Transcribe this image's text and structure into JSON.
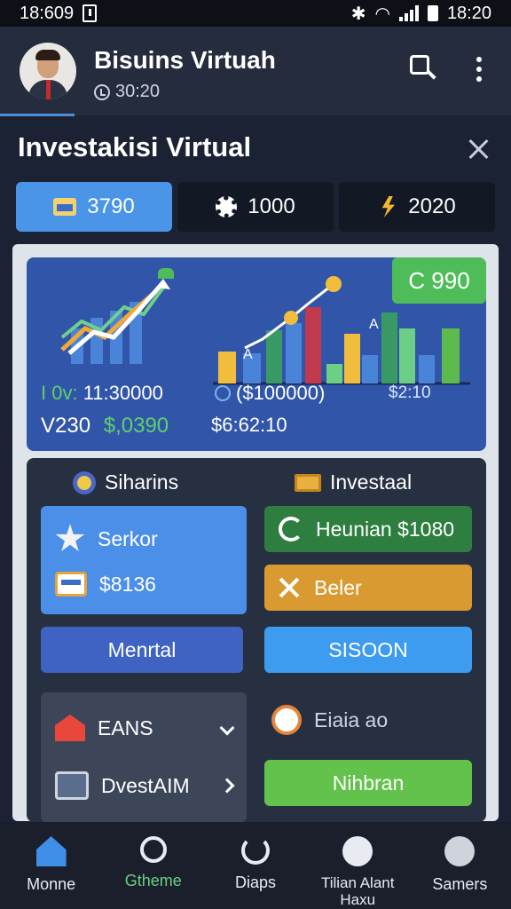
{
  "status_bar": {
    "time_left": "18:609",
    "time_right": "18:20"
  },
  "header": {
    "title": "Bisuins Virtuah",
    "subtitle": "30:20"
  },
  "section_title": "Investakisi Virtual",
  "chips": [
    {
      "label": "3790",
      "icon": "wallet-icon",
      "active": true
    },
    {
      "label": "1000",
      "icon": "gear-icon",
      "active": false
    },
    {
      "label": "2020",
      "icon": "bolt-icon",
      "active": false
    }
  ],
  "overview": {
    "badge": "C 990",
    "stat1_label": "I 0v:",
    "stat1_value": "11:30000",
    "stat2_value": "($100000)",
    "stat3_value": "$2:10",
    "stat4_label": "V230",
    "stat4_value": "$,0390",
    "stat5_value": "$6:62:10",
    "bar_label_a1": "A",
    "bar_label_a2": "A"
  },
  "panel": {
    "left_heading": "Siharins",
    "right_heading": "Investaal",
    "tile_left_item1": "Serkor",
    "tile_left_item2": "$8136",
    "tile_right_1": "Heunian $1080",
    "tile_right_2": "Beler",
    "btn_left": "Menrtal",
    "btn_right": "SISOON",
    "list_item1": "EANS",
    "list_item2": "DvestAIM",
    "right_misc": "Eiaia ao",
    "btn_green": "Nihbran"
  },
  "nav": [
    {
      "label": "Monne",
      "active": false
    },
    {
      "label": "Gtheme",
      "active": true
    },
    {
      "label": "Diaps",
      "active": false
    },
    {
      "label": "Tilian Alant Haxu",
      "active": false
    },
    {
      "label": "Samers",
      "active": false
    }
  ],
  "colors": {
    "accent": "#4b95e9",
    "card": "#3156a9",
    "positive": "#5fd06a",
    "background": "#1b2233"
  }
}
